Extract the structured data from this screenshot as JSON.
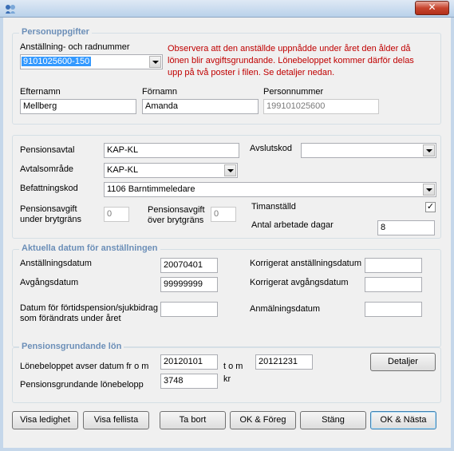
{
  "window": {
    "close_glyph": "✕"
  },
  "personuppgifter": {
    "legend": "Personuppgifter",
    "anstallning_label": "Anställning- och radnummer",
    "anstallning_value": "9101025600-150",
    "warning": "Observera att den anställde uppnådde under året den ålder då lönen blir avgiftsgrundande. Lönebeloppet kommer därför delas upp på två poster i filen. Se detaljer nedan.",
    "efternamn_label": "Efternamn",
    "efternamn_value": "Mellberg",
    "fornamn_label": "Förnamn",
    "fornamn_value": "Amanda",
    "personnummer_label": "Personnummer",
    "personnummer_value": "199101025600"
  },
  "pension": {
    "pensionsavtal_label": "Pensionsavtal",
    "pensionsavtal_value": "KAP-KL",
    "avslutskod_label": "Avslutskod",
    "avslutskod_value": "",
    "avtalsomrade_label": "Avtalsområde",
    "avtalsomrade_value": "KAP-KL",
    "befattningskod_label": "Befattningskod",
    "befattningskod_value": "1106 Barntimmeledare",
    "avgift_under_label_1": "Pensionsavgift",
    "avgift_under_label_2": "under brytgräns",
    "avgift_under_value": "0",
    "avgift_over_label_1": "Pensionsavgift",
    "avgift_over_label_2": "över brytgräns",
    "avgift_over_value": "0",
    "timanstalld_label": "Timanställd",
    "timanstalld_checked": "✓",
    "antal_dagar_label": "Antal arbetade dagar",
    "antal_dagar_value": "8"
  },
  "datum": {
    "legend": "Aktuella datum för anställningen",
    "anstallningsdatum_label": "Anställningsdatum",
    "anstallningsdatum_value": "20070401",
    "avgangsdatum_label": "Avgångsdatum",
    "avgangsdatum_value": "99999999",
    "fortid_label_1": "Datum för förtidspension/sjukbidrag",
    "fortid_label_2": "som förändrats under året",
    "fortid_value": "",
    "korr_anst_label": "Korrigerat anställningsdatum",
    "korr_anst_value": "",
    "korr_avg_label": "Korrigerat avgångsdatum",
    "korr_avg_value": "",
    "anmalan_label": "Anmälningsdatum",
    "anmalan_value": ""
  },
  "lon": {
    "legend": "Pensionsgrundande lön",
    "lonebelopp_label": "Lönebeloppet avser datum fr o m",
    "from_value": "20120101",
    "tom_label": "t o m",
    "to_value": "20121231",
    "pgl_label": "Pensionsgrundande lönebelopp",
    "pgl_value": "3748",
    "kr_label": "kr",
    "detaljer_button": "Detaljer"
  },
  "buttons": {
    "visa_ledighet": "Visa ledighet",
    "visa_fellista": "Visa fellista",
    "ta_bort": "Ta bort",
    "ok_foreg": "OK & Föreg",
    "stang": "Stäng",
    "ok_nasta": "OK & Nästa"
  }
}
